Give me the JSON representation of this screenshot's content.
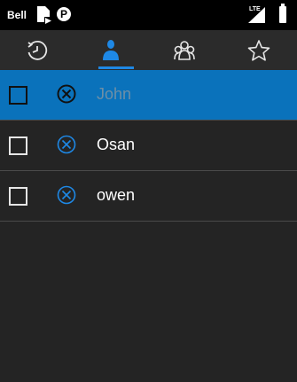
{
  "status_bar": {
    "carrier": "Bell",
    "parking_badge": "P",
    "network_type": "LTE",
    "icons": [
      "sim-card-icon",
      "parking-icon",
      "signal-icon",
      "battery-icon"
    ]
  },
  "tabs": [
    {
      "name": "recent",
      "icon": "history-icon",
      "selected": false
    },
    {
      "name": "contact",
      "icon": "person-icon",
      "selected": true
    },
    {
      "name": "groups",
      "icon": "group-icon",
      "selected": false
    },
    {
      "name": "favorites",
      "icon": "star-icon",
      "selected": false
    }
  ],
  "contacts": [
    {
      "name": "John",
      "checked": false,
      "selected": true
    },
    {
      "name": "Osan",
      "checked": false,
      "selected": false
    },
    {
      "name": "owen",
      "checked": false,
      "selected": false
    }
  ],
  "colors": {
    "accent": "#1e88e5",
    "selected_row": "#0a72bb",
    "background": "#242424",
    "tabbar": "#2b2b2b"
  }
}
